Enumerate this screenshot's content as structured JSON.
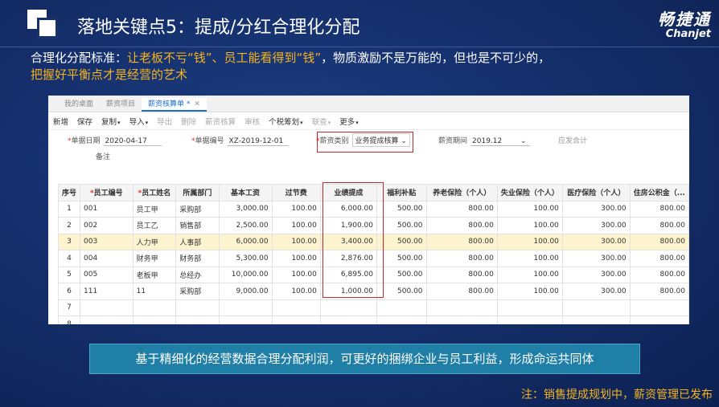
{
  "title": "落地关键点5：提成/分红合理化分配",
  "brand": {
    "cn": "畅捷通",
    "en": "Chanjet"
  },
  "subtitle": {
    "prefix": "合理化分配标准：",
    "highlight1": "让老板不亏“钱”、员工能看得到“钱”",
    "middle": "，物质激励不是万能的，但也是不可少的，",
    "highlight2": "把握好平衡点才是经营的艺术"
  },
  "app": {
    "tabs": [
      {
        "label": "我的桌面",
        "active": false
      },
      {
        "label": "薪资项目",
        "active": false
      },
      {
        "label": "薪资核算单 *",
        "active": true
      }
    ],
    "toolbar": [
      {
        "label": "新增",
        "disabled": false,
        "caret": false
      },
      {
        "label": "保存",
        "disabled": false,
        "caret": false
      },
      {
        "label": "复制",
        "disabled": false,
        "caret": true
      },
      {
        "label": "导入",
        "disabled": false,
        "caret": true
      },
      {
        "label": "导出",
        "disabled": true,
        "caret": false
      },
      {
        "label": "删除",
        "disabled": true,
        "caret": false
      },
      {
        "label": "薪资核算",
        "disabled": true,
        "caret": false
      },
      {
        "label": "审核",
        "disabled": true,
        "caret": false
      },
      {
        "label": "个税筹划",
        "disabled": false,
        "caret": true
      },
      {
        "label": "联查",
        "disabled": true,
        "caret": true
      },
      {
        "label": "更多",
        "disabled": false,
        "caret": true
      }
    ],
    "form": {
      "date_label": "单据日期",
      "date_value": "2020-04-17",
      "number_label": "单据编号",
      "number_value": "XZ-2019-12-01",
      "type_label": "薪资类别",
      "type_value": "业务提成核算",
      "period_label": "薪资期间",
      "period_value": "2019.12",
      "total_label": "应发合计",
      "remark_label": "备注"
    },
    "table": {
      "headers": [
        "序号",
        "员工编号",
        "员工姓名",
        "所属部门",
        "基本工资",
        "过节费",
        "业绩提成",
        "福利补贴",
        "养老保险（个人）",
        "失业保险（个人）",
        "医疗保险（个人）",
        "住房公积金（..."
      ],
      "rows": [
        [
          "1",
          "001",
          "员工甲",
          "采购部",
          "3,000.00",
          "100.00",
          "6,000.00",
          "500.00",
          "800.00",
          "100.00",
          "300.00",
          "800.00"
        ],
        [
          "2",
          "002",
          "员工乙",
          "销售部",
          "2,500.00",
          "100.00",
          "1,900.00",
          "500.00",
          "800.00",
          "100.00",
          "300.00",
          "800.00"
        ],
        [
          "3",
          "003",
          "人力甲",
          "人事部",
          "6,000.00",
          "100.00",
          "3,400.00",
          "500.00",
          "800.00",
          "100.00",
          "300.00",
          "800.00"
        ],
        [
          "4",
          "004",
          "财务甲",
          "财务部",
          "5,300.00",
          "100.00",
          "2,876.00",
          "500.00",
          "800.00",
          "100.00",
          "300.00",
          "800.00"
        ],
        [
          "5",
          "005",
          "老板甲",
          "总经办",
          "10,000.00",
          "100.00",
          "6,895.00",
          "500.00",
          "800.00",
          "100.00",
          "300.00",
          "800.00"
        ],
        [
          "6",
          "111",
          "11",
          "采购部",
          "9,000.00",
          "100.00",
          "1,000.00",
          "500.00",
          "800.00",
          "100.00",
          "300.00",
          "800.00"
        ],
        [
          "7",
          "",
          "",
          "",
          "",
          "",
          "",
          "",
          "",
          "",
          "",
          ""
        ],
        [
          "8",
          "",
          "",
          "",
          "",
          "",
          "",
          "",
          "",
          "",
          "",
          ""
        ]
      ]
    }
  },
  "banner": "基于精细化的经营数据合理分配利润，可更好的捆绑企业与员工利益，形成命运共同体",
  "note": "注：销售提成规划中，薪资管理已发布"
}
